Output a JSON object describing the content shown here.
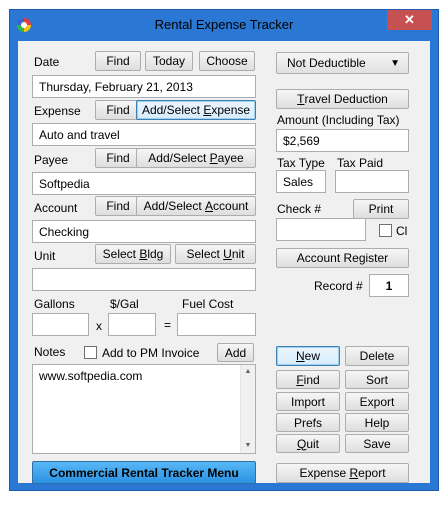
{
  "window": {
    "title": "Rental Expense Tracker",
    "close_glyph": "✕"
  },
  "date": {
    "label": "Date",
    "find": "Find",
    "today": "Today",
    "choose": "Choose",
    "value": "Thursday, February 21, 2013"
  },
  "expense": {
    "label": "Expense",
    "find": "Find",
    "select_pre": "Add/Select ",
    "select_u": "E",
    "select_post": "xpense",
    "value": "Auto and travel"
  },
  "payee": {
    "label": "Payee",
    "find": "Find",
    "select_pre": "Add/Select ",
    "select_u": "P",
    "select_post": "ayee",
    "value": "Softpedia"
  },
  "account": {
    "label": "Account",
    "find": "Find",
    "select_pre": "Add/Select ",
    "select_u": "A",
    "select_post": "ccount",
    "value": "Checking"
  },
  "unit": {
    "label": "Unit",
    "bldg_pre": "Select ",
    "bldg_u": "B",
    "bldg_post": "ldg",
    "unit_pre": "Select ",
    "unit_u": "U",
    "unit_post": "nit",
    "value": ""
  },
  "calc": {
    "gallons": "Gallons",
    "per_gal": "$/Gal",
    "fuel_cost": "Fuel Cost",
    "times": "x",
    "equals": "="
  },
  "notes": {
    "label": "Notes",
    "add_pm": "Add to PM Invoice",
    "add": "Add",
    "value": "www.softpedia.com"
  },
  "menu_button": "Commercial Rental Tracker Menu",
  "deduct": {
    "selected": "Not Deductible",
    "travel_u": "T",
    "travel_post": "ravel Deduction"
  },
  "amount": {
    "label": "Amount (Including Tax)",
    "value": "$2,569"
  },
  "tax": {
    "type_label": "Tax Type",
    "paid_label": "Tax Paid",
    "type_value": "Sales",
    "paid_value": ""
  },
  "check": {
    "label": "Check #",
    "print": "Print",
    "cl": "Cl",
    "value": ""
  },
  "register_button": "Account Register",
  "record": {
    "label": "Record #",
    "value": "1"
  },
  "actions": {
    "new_u": "N",
    "new_post": "ew",
    "delete": "Delete",
    "find_u": "F",
    "find_post": "ind",
    "sort": "Sort",
    "import": "Import",
    "export": "Export",
    "prefs": "Prefs",
    "help": "Help",
    "quit_u": "Q",
    "quit_post": "uit",
    "save": "Save"
  },
  "report": {
    "pre": "Expense ",
    "u": "R",
    "post": "eport"
  }
}
